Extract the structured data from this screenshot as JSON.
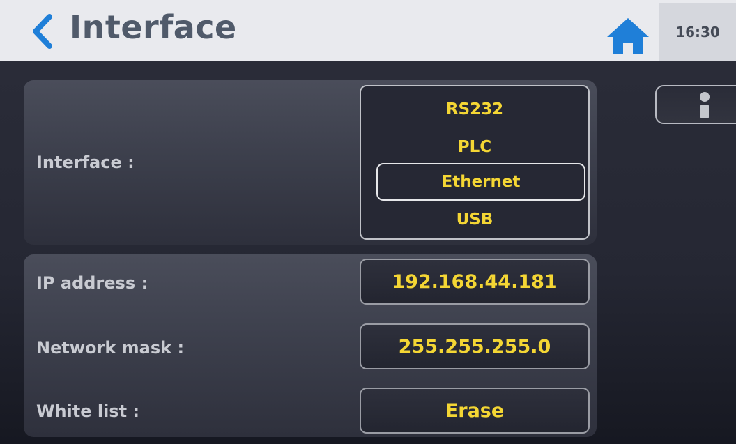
{
  "header": {
    "title": "Interface",
    "time": "16:30"
  },
  "interface_panel": {
    "label": "Interface :",
    "options": [
      "RS232",
      "PLC",
      "Ethernet",
      "USB"
    ],
    "selected": "Ethernet"
  },
  "network_panel": {
    "ip_label": "IP address :",
    "ip_value": "192.168.44.181",
    "mask_label": "Network mask :",
    "mask_value": "255.255.255.0",
    "whitelist_label": "White list :",
    "whitelist_button": "Erase"
  },
  "icons": {
    "back": "chevron-left-icon",
    "home": "home-icon",
    "info": "info-icon"
  },
  "colors": {
    "accent_blue": "#1f7fd8",
    "value_yellow": "#f4d634",
    "label_gray": "#c9cbd2",
    "title_gray": "#505a6a"
  }
}
